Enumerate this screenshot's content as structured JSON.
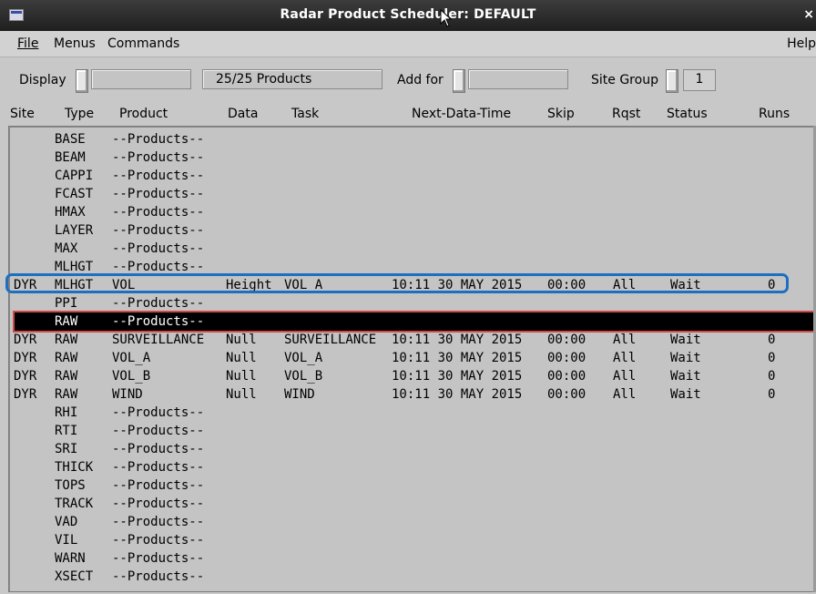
{
  "window": {
    "title": "Radar  Product Scheduler: DEFAULT",
    "close_glyph": "×"
  },
  "menu": {
    "file": "File",
    "menus": "Menus",
    "commands": "Commands",
    "help": "Help"
  },
  "toolbar": {
    "display_label": "Display",
    "products_count": "25/25 Products",
    "add_for_label": "Add for",
    "site_group_label": "Site Group",
    "site_group_value": "1"
  },
  "columns": {
    "site": "Site",
    "type": "Type",
    "product": "Product",
    "data": "Data",
    "task": "Task",
    "next_data_time": "Next-Data-Time",
    "skip": "Skip",
    "rqst": "Rqst",
    "status": "Status",
    "runs": "Runs"
  },
  "rows": [
    {
      "site": "",
      "type": "BASE",
      "product": "--Products--",
      "data": "",
      "task": "",
      "time": "",
      "skip": "",
      "rqst": "",
      "status": "",
      "runs": ""
    },
    {
      "site": "",
      "type": "BEAM",
      "product": "--Products--",
      "data": "",
      "task": "",
      "time": "",
      "skip": "",
      "rqst": "",
      "status": "",
      "runs": ""
    },
    {
      "site": "",
      "type": "CAPPI",
      "product": "--Products--",
      "data": "",
      "task": "",
      "time": "",
      "skip": "",
      "rqst": "",
      "status": "",
      "runs": ""
    },
    {
      "site": "",
      "type": "FCAST",
      "product": "--Products--",
      "data": "",
      "task": "",
      "time": "",
      "skip": "",
      "rqst": "",
      "status": "",
      "runs": ""
    },
    {
      "site": "",
      "type": "HMAX",
      "product": "--Products--",
      "data": "",
      "task": "",
      "time": "",
      "skip": "",
      "rqst": "",
      "status": "",
      "runs": ""
    },
    {
      "site": "",
      "type": "LAYER",
      "product": "--Products--",
      "data": "",
      "task": "",
      "time": "",
      "skip": "",
      "rqst": "",
      "status": "",
      "runs": ""
    },
    {
      "site": "",
      "type": "MAX",
      "product": "--Products--",
      "data": "",
      "task": "",
      "time": "",
      "skip": "",
      "rqst": "",
      "status": "",
      "runs": ""
    },
    {
      "site": "",
      "type": "MLHGT",
      "product": "--Products--",
      "data": "",
      "task": "",
      "time": "",
      "skip": "",
      "rqst": "",
      "status": "",
      "runs": ""
    },
    {
      "site": "DYR",
      "type": "MLHGT",
      "product": "VOL",
      "data": "Height",
      "task": "VOL A",
      "time": "10:11 30 MAY 2015",
      "skip": "00:00",
      "rqst": "All",
      "status": "Wait",
      "runs": "0"
    },
    {
      "site": "",
      "type": "PPI",
      "product": "--Products--",
      "data": "",
      "task": "",
      "time": "",
      "skip": "",
      "rqst": "",
      "status": "",
      "runs": ""
    },
    {
      "site": "",
      "type": "RAW",
      "product": "--Products--",
      "data": "",
      "task": "",
      "time": "",
      "skip": "",
      "rqst": "",
      "status": "",
      "runs": ""
    },
    {
      "site": "DYR",
      "type": "RAW",
      "product": "SURVEILLANCE",
      "data": "Null",
      "task": "SURVEILLANCE",
      "time": "10:11 30 MAY 2015",
      "skip": "00:00",
      "rqst": "All",
      "status": "Wait",
      "runs": "0"
    },
    {
      "site": "DYR",
      "type": "RAW",
      "product": "VOL_A",
      "data": "Null",
      "task": "VOL_A",
      "time": "10:11 30 MAY 2015",
      "skip": "00:00",
      "rqst": "All",
      "status": "Wait",
      "runs": "0"
    },
    {
      "site": "DYR",
      "type": "RAW",
      "product": "VOL_B",
      "data": "Null",
      "task": "VOL_B",
      "time": "10:11 30 MAY 2015",
      "skip": "00:00",
      "rqst": "All",
      "status": "Wait",
      "runs": "0"
    },
    {
      "site": "DYR",
      "type": "RAW",
      "product": "WIND",
      "data": "Null",
      "task": "WIND",
      "time": "10:11 30 MAY 2015",
      "skip": "00:00",
      "rqst": "All",
      "status": "Wait",
      "runs": "0"
    },
    {
      "site": "",
      "type": "RHI",
      "product": "--Products--",
      "data": "",
      "task": "",
      "time": "",
      "skip": "",
      "rqst": "",
      "status": "",
      "runs": ""
    },
    {
      "site": "",
      "type": "RTI",
      "product": "--Products--",
      "data": "",
      "task": "",
      "time": "",
      "skip": "",
      "rqst": "",
      "status": "",
      "runs": ""
    },
    {
      "site": "",
      "type": "SRI",
      "product": "--Products--",
      "data": "",
      "task": "",
      "time": "",
      "skip": "",
      "rqst": "",
      "status": "",
      "runs": ""
    },
    {
      "site": "",
      "type": "THICK",
      "product": "--Products--",
      "data": "",
      "task": "",
      "time": "",
      "skip": "",
      "rqst": "",
      "status": "",
      "runs": ""
    },
    {
      "site": "",
      "type": "TOPS",
      "product": "--Products--",
      "data": "",
      "task": "",
      "time": "",
      "skip": "",
      "rqst": "",
      "status": "",
      "runs": ""
    },
    {
      "site": "",
      "type": "TRACK",
      "product": "--Products--",
      "data": "",
      "task": "",
      "time": "",
      "skip": "",
      "rqst": "",
      "status": "",
      "runs": ""
    },
    {
      "site": "",
      "type": "VAD",
      "product": "--Products--",
      "data": "",
      "task": "",
      "time": "",
      "skip": "",
      "rqst": "",
      "status": "",
      "runs": ""
    },
    {
      "site": "",
      "type": "VIL",
      "product": "--Products--",
      "data": "",
      "task": "",
      "time": "",
      "skip": "",
      "rqst": "",
      "status": "",
      "runs": ""
    },
    {
      "site": "",
      "type": "WARN",
      "product": "--Products--",
      "data": "",
      "task": "",
      "time": "",
      "skip": "",
      "rqst": "",
      "status": "",
      "runs": ""
    },
    {
      "site": "",
      "type": "XSECT",
      "product": "--Products--",
      "data": "",
      "task": "",
      "time": "",
      "skip": "",
      "rqst": "",
      "status": "",
      "runs": ""
    }
  ],
  "selected_row_index": 10,
  "highlighted_row_index": 8,
  "colors": {
    "highlight_outline": "#1e6fc2",
    "selected_outline": "#d14a4a",
    "selected_bg": "#000000"
  }
}
